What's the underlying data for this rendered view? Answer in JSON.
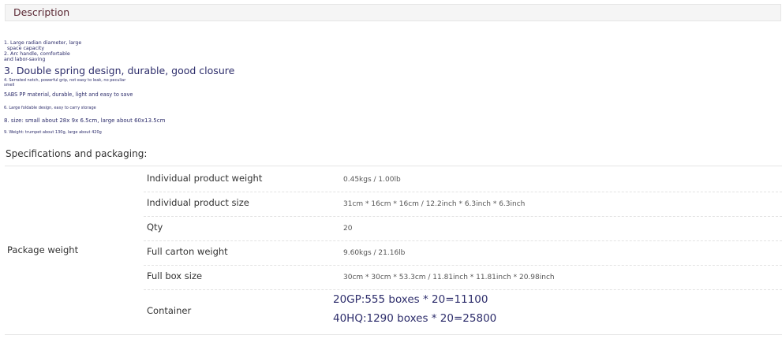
{
  "tab": {
    "title": "Description"
  },
  "features": {
    "f1a": "1. Large radian diameter, large",
    "f1b": "space capacity",
    "f2a": "2. Arc handle, comfortable",
    "f2b": "and labor-saving",
    "f3": "3. Double spring design, durable, good closure",
    "f4a": "4. Serrated notch, powerful grip, not easy to leak, no peculiar",
    "f4b": "smell",
    "f5": "5ABS PP material, durable, light and easy to save",
    "f6": "6. Large foldable design, easy to carry storage",
    "f8": "8. size: small about 28x 9x 6.5cm, large about 60x13.5cm",
    "f9": "9. Weight: trumpet about 130g, large about 420g"
  },
  "specs": {
    "title": "Specifications and packaging:",
    "group_label": "Package weight",
    "rows": [
      {
        "label": "Individual product weight",
        "value": "0.45kgs / 1.00lb"
      },
      {
        "label": "Individual product size",
        "value": "31cm * 16cm * 16cm / 12.2inch * 6.3inch * 6.3inch"
      },
      {
        "label": "Qty",
        "value": "20"
      },
      {
        "label": "Full carton weight",
        "value": "9.60kgs / 21.16lb"
      },
      {
        "label": "Full box size",
        "value": "30cm * 30cm * 53.3cm / 11.81inch * 11.81inch * 20.98inch"
      }
    ],
    "container": {
      "label": "Container",
      "line1": "20GP:555 boxes * 20=11100",
      "line2": "40HQ:1290 boxes * 20=25800"
    }
  }
}
